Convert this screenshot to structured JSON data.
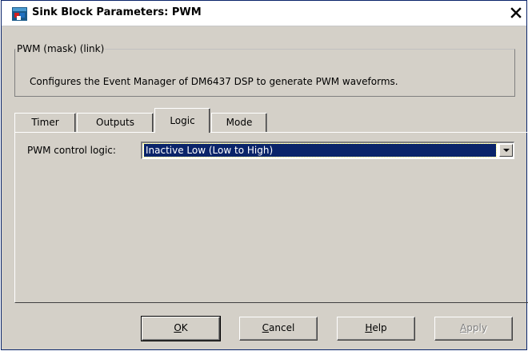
{
  "window": {
    "title": "Sink Block Parameters: PWM",
    "close_glyph": "✕"
  },
  "description": {
    "group_label": "PWM (mask) (link)",
    "text": "Configures the Event Manager of DM6437 DSP to generate PWM waveforms."
  },
  "tabs": [
    {
      "label": "Timer",
      "active": false
    },
    {
      "label": "Outputs",
      "active": false
    },
    {
      "label": "Logic",
      "active": true
    },
    {
      "label": "Mode",
      "active": false
    }
  ],
  "logic_panel": {
    "pwm_control_logic_label": "PWM control logic:",
    "pwm_control_logic_value": "Inactive Low (Low to High)"
  },
  "buttons": {
    "ok": {
      "mnemonic": "O",
      "rest": "K",
      "enabled": true
    },
    "cancel": {
      "mnemonic": "C",
      "rest": "ancel",
      "enabled": true
    },
    "help": {
      "mnemonic": "H",
      "rest": "elp",
      "enabled": true
    },
    "apply": {
      "mnemonic": "A",
      "rest": "pply",
      "enabled": false
    }
  },
  "icons": {
    "app": "simulink-block-icon",
    "close": "close-icon",
    "dropdown": "chevron-down-icon"
  }
}
